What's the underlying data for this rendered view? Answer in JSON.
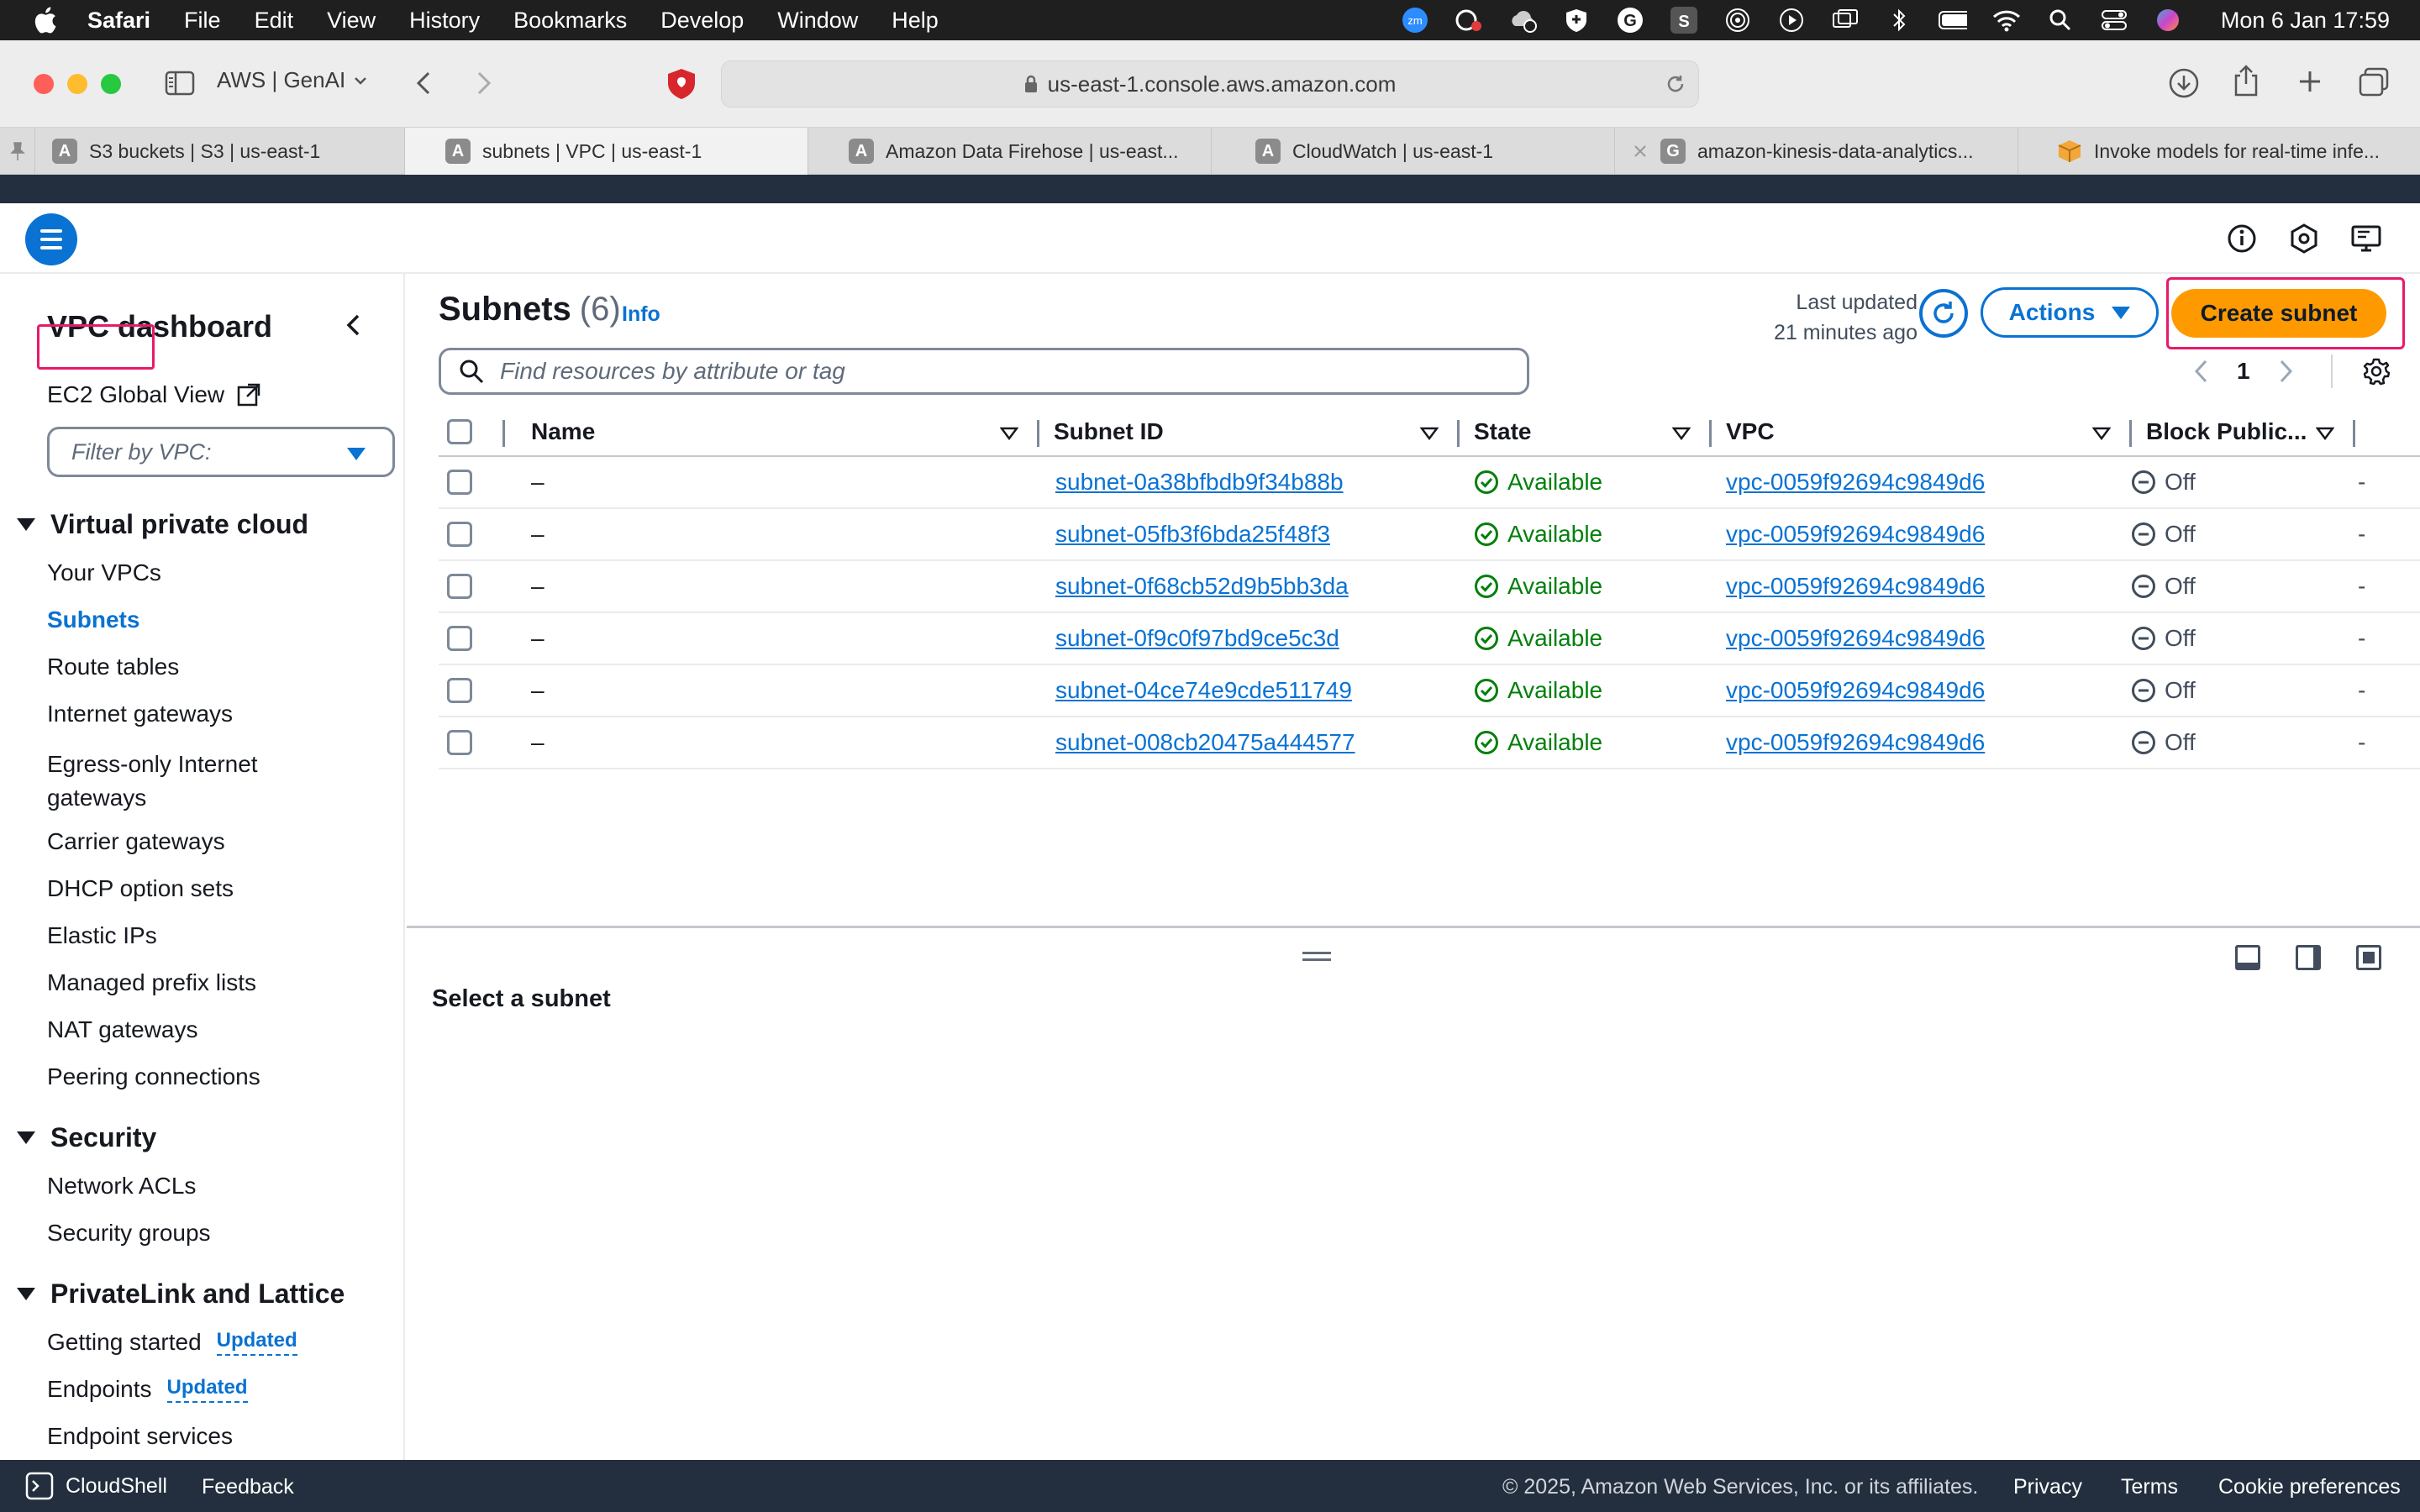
{
  "menubar": {
    "app": "Safari",
    "items": [
      "File",
      "Edit",
      "View",
      "History",
      "Bookmarks",
      "Develop",
      "Window",
      "Help"
    ],
    "clock": "Mon 6 Jan  17:59"
  },
  "browser": {
    "profile": "AWS | GenAI",
    "url": "us-east-1.console.aws.amazon.com",
    "tabs": [
      {
        "label": "S3 buckets | S3 | us-east-1",
        "favicon": "A"
      },
      {
        "label": "subnets | VPC | us-east-1",
        "favicon": "A"
      },
      {
        "label": "Amazon Data Firehose | us-east...",
        "favicon": "A"
      },
      {
        "label": "CloudWatch | us-east-1",
        "favicon": "A"
      },
      {
        "label": "amazon-kinesis-data-analytics...",
        "favicon": "G"
      },
      {
        "label": "Invoke models for real-time infe...",
        "favicon": ""
      }
    ]
  },
  "sidebar": {
    "title": "VPC dashboard",
    "ec2_global": "EC2 Global View",
    "filter_placeholder": "Filter by VPC:",
    "sections": [
      {
        "title": "Virtual private cloud",
        "items": [
          "Your VPCs",
          "Subnets",
          "Route tables",
          "Internet gateways",
          "Egress-only Internet gateways",
          "Carrier gateways",
          "DHCP option sets",
          "Elastic IPs",
          "Managed prefix lists",
          "NAT gateways",
          "Peering connections"
        ]
      },
      {
        "title": "Security",
        "items": [
          "Network ACLs",
          "Security groups"
        ]
      },
      {
        "title": "PrivateLink and Lattice",
        "items": [
          "Getting started",
          "Endpoints",
          "Endpoint services"
        ]
      }
    ],
    "egress_line1": "Egress-only Internet",
    "egress_line2": "gateways",
    "updated_badge": "Updated"
  },
  "main": {
    "title": "Subnets",
    "count": "(6)",
    "info": "Info",
    "last_updated_label": "Last updated",
    "last_updated_value": "21 minutes ago",
    "actions_label": "Actions",
    "create_label": "Create subnet",
    "search_placeholder": "Find resources by attribute or tag",
    "page": "1",
    "columns": [
      "Name",
      "Subnet ID",
      "State",
      "VPC",
      "Block Public..."
    ],
    "rows": [
      {
        "name": "–",
        "subnet_id": "subnet-0a38bfbdb9f34b88b",
        "state": "Available",
        "vpc": "vpc-0059f92694c9849d6",
        "block": "Off"
      },
      {
        "name": "–",
        "subnet_id": "subnet-05fb3f6bda25f48f3",
        "state": "Available",
        "vpc": "vpc-0059f92694c9849d6",
        "block": "Off"
      },
      {
        "name": "–",
        "subnet_id": "subnet-0f68cb52d9b5bb3da",
        "state": "Available",
        "vpc": "vpc-0059f92694c9849d6",
        "block": "Off"
      },
      {
        "name": "–",
        "subnet_id": "subnet-0f9c0f97bd9ce5c3d",
        "state": "Available",
        "vpc": "vpc-0059f92694c9849d6",
        "block": "Off"
      },
      {
        "name": "–",
        "subnet_id": "subnet-04ce74e9cde511749",
        "state": "Available",
        "vpc": "vpc-0059f92694c9849d6",
        "block": "Off"
      },
      {
        "name": "–",
        "subnet_id": "subnet-008cb20475a444577",
        "state": "Available",
        "vpc": "vpc-0059f92694c9849d6",
        "block": "Off"
      }
    ]
  },
  "split_panel": {
    "title": "Select a subnet"
  },
  "footer": {
    "cloudshell": "CloudShell",
    "feedback": "Feedback",
    "copyright": "© 2025, Amazon Web Services, Inc. or its affiliates.",
    "privacy": "Privacy",
    "terms": "Terms",
    "cookies": "Cookie preferences"
  },
  "colors": {
    "accent": "#0972d3",
    "primary_button": "#ff9900",
    "available": "#037f0c",
    "highlight": "#e8196a",
    "header_dark": "#232f3e"
  }
}
